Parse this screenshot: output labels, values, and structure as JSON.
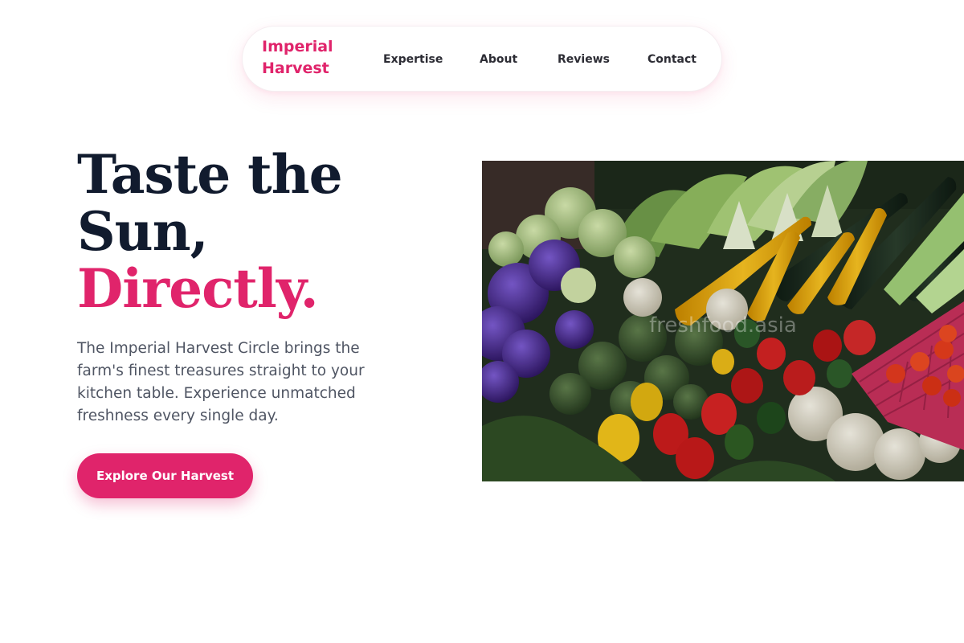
{
  "nav": {
    "brand": "Imperial Harvest",
    "links": [
      {
        "label": "Expertise"
      },
      {
        "label": "About"
      },
      {
        "label": "Reviews"
      },
      {
        "label": "Contact"
      }
    ]
  },
  "hero": {
    "headline_line1": "Taste the",
    "headline_line2": "Sun,",
    "headline_accent": "Directly.",
    "description": "The Imperial Harvest Circle brings the farm's finest treasures straight to your kitchen table. Experience unmatched freshness every single day.",
    "cta_label": "Explore Our Harvest",
    "image_watermark": "freshfood.asia"
  },
  "colors": {
    "accent": "#e0246b",
    "heading": "#111b2e",
    "body_text": "#4f5563"
  }
}
